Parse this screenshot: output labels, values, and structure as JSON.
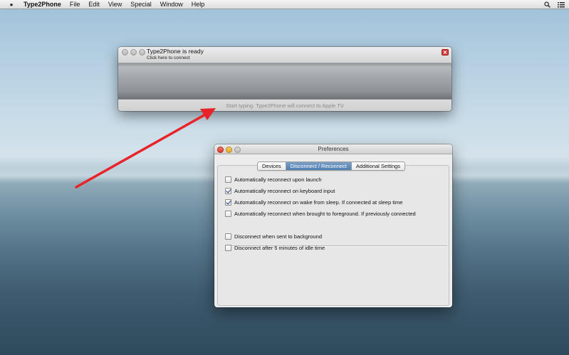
{
  "menubar": {
    "apple_icon": "apple-logo-icon",
    "app_name": "Type2Phone",
    "menus": [
      "File",
      "Edit",
      "View",
      "Special",
      "Window",
      "Help"
    ],
    "right_icons": [
      "search-icon",
      "list-menu-icon"
    ]
  },
  "t2p_window": {
    "status_title": "Type2Phone is ready",
    "status_subtitle": "Click here to connect",
    "input_placeholder": "Start typing. Type2Phone will connect to Apple TV"
  },
  "preferences": {
    "title": "Preferences",
    "tabs": [
      {
        "label": "Devices",
        "active": false
      },
      {
        "label": "Disconnect / Reconnect",
        "active": true
      },
      {
        "label": "Additional Settings",
        "active": false
      }
    ],
    "reconnect_options": [
      {
        "label": "Automatically reconnect upon launch",
        "checked": false
      },
      {
        "label": "Automatically reconnect on keyboard input",
        "checked": true
      },
      {
        "label": "Automatically reconnect on wake from sleep. If connected at sleep time",
        "checked": true
      },
      {
        "label": "Automatically reconnect when brought to foreground. If previously connected",
        "checked": false
      }
    ],
    "disconnect_options": [
      {
        "label": "Disconnect when sent to background",
        "checked": false
      },
      {
        "label": "Disconnect after 5 minutes of idle time",
        "checked": false
      }
    ]
  },
  "colors": {
    "arrow": "#e8242a",
    "tab_active": "#4f7eb2",
    "close_button": "#d93a3a"
  }
}
